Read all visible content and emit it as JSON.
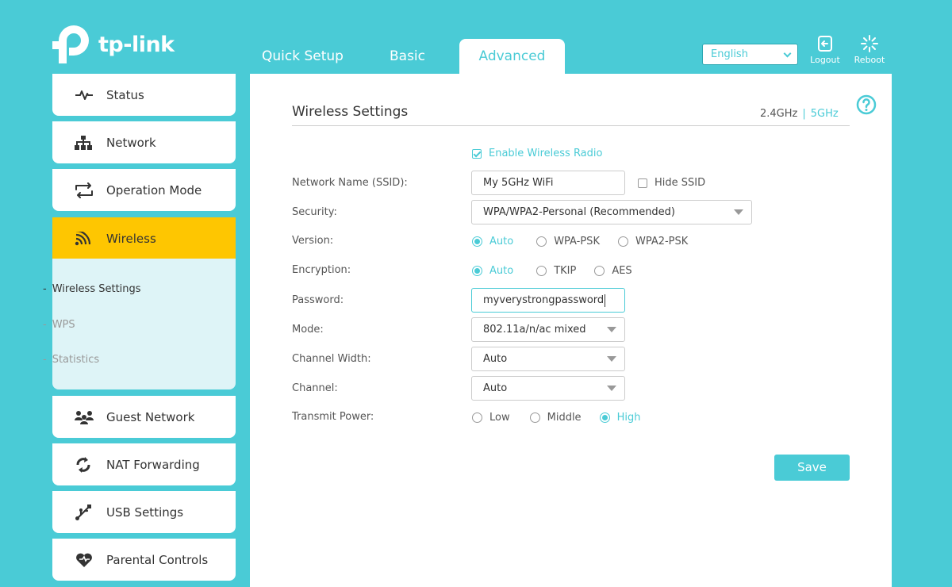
{
  "brand": {
    "name": "tp-link"
  },
  "tabs": [
    {
      "label": "Quick Setup"
    },
    {
      "label": "Basic"
    },
    {
      "label": "Advanced",
      "active": true
    }
  ],
  "language": {
    "selected": "English"
  },
  "top_actions": {
    "logout": "Logout",
    "reboot": "Reboot"
  },
  "sidebar": {
    "items": [
      {
        "label": "Status",
        "icon": "pulse-icon"
      },
      {
        "label": "Network",
        "icon": "network-icon"
      },
      {
        "label": "Operation Mode",
        "icon": "swap-icon"
      },
      {
        "label": "Wireless",
        "icon": "wifi-icon",
        "active": true
      },
      {
        "label": "Guest Network",
        "icon": "guests-icon"
      },
      {
        "label": "NAT Forwarding",
        "icon": "nat-icon"
      },
      {
        "label": "USB Settings",
        "icon": "usb-icon"
      },
      {
        "label": "Parental Controls",
        "icon": "heart-icon"
      }
    ],
    "sub_items": [
      {
        "label": "Wireless Settings",
        "current": true
      },
      {
        "label": "WPS"
      },
      {
        "label": "Statistics"
      }
    ],
    "dash": "-"
  },
  "main": {
    "title": "Wireless Settings",
    "band_24": "2.4GHz",
    "band_sep": "|",
    "band_5": "5GHz",
    "enable_radio": {
      "label": "Enable Wireless Radio",
      "checked": true
    },
    "ssid": {
      "label": "Network Name (SSID):",
      "value": "My 5GHz WiFi",
      "hide_label": "Hide SSID",
      "hide_checked": false
    },
    "security": {
      "label": "Security:",
      "value": "WPA/WPA2-Personal (Recommended)"
    },
    "version": {
      "label": "Version:",
      "options": [
        "Auto",
        "WPA-PSK",
        "WPA2-PSK"
      ],
      "selected": "Auto"
    },
    "encryption": {
      "label": "Encryption:",
      "options": [
        "Auto",
        "TKIP",
        "AES"
      ],
      "selected": "Auto"
    },
    "password": {
      "label": "Password:",
      "value": "myverystrongpassword"
    },
    "mode": {
      "label": "Mode:",
      "value": "802.11a/n/ac mixed"
    },
    "channel_width": {
      "label": "Channel Width:",
      "value": "Auto"
    },
    "channel": {
      "label": "Channel:",
      "value": "Auto"
    },
    "transmit_power": {
      "label": "Transmit Power:",
      "options": [
        "Low",
        "Middle",
        "High"
      ],
      "selected": "High"
    },
    "save_label": "Save"
  },
  "colors": {
    "brand": "#4acbd6",
    "active_nav": "#fec601",
    "sub_panel": "#def4f7"
  }
}
